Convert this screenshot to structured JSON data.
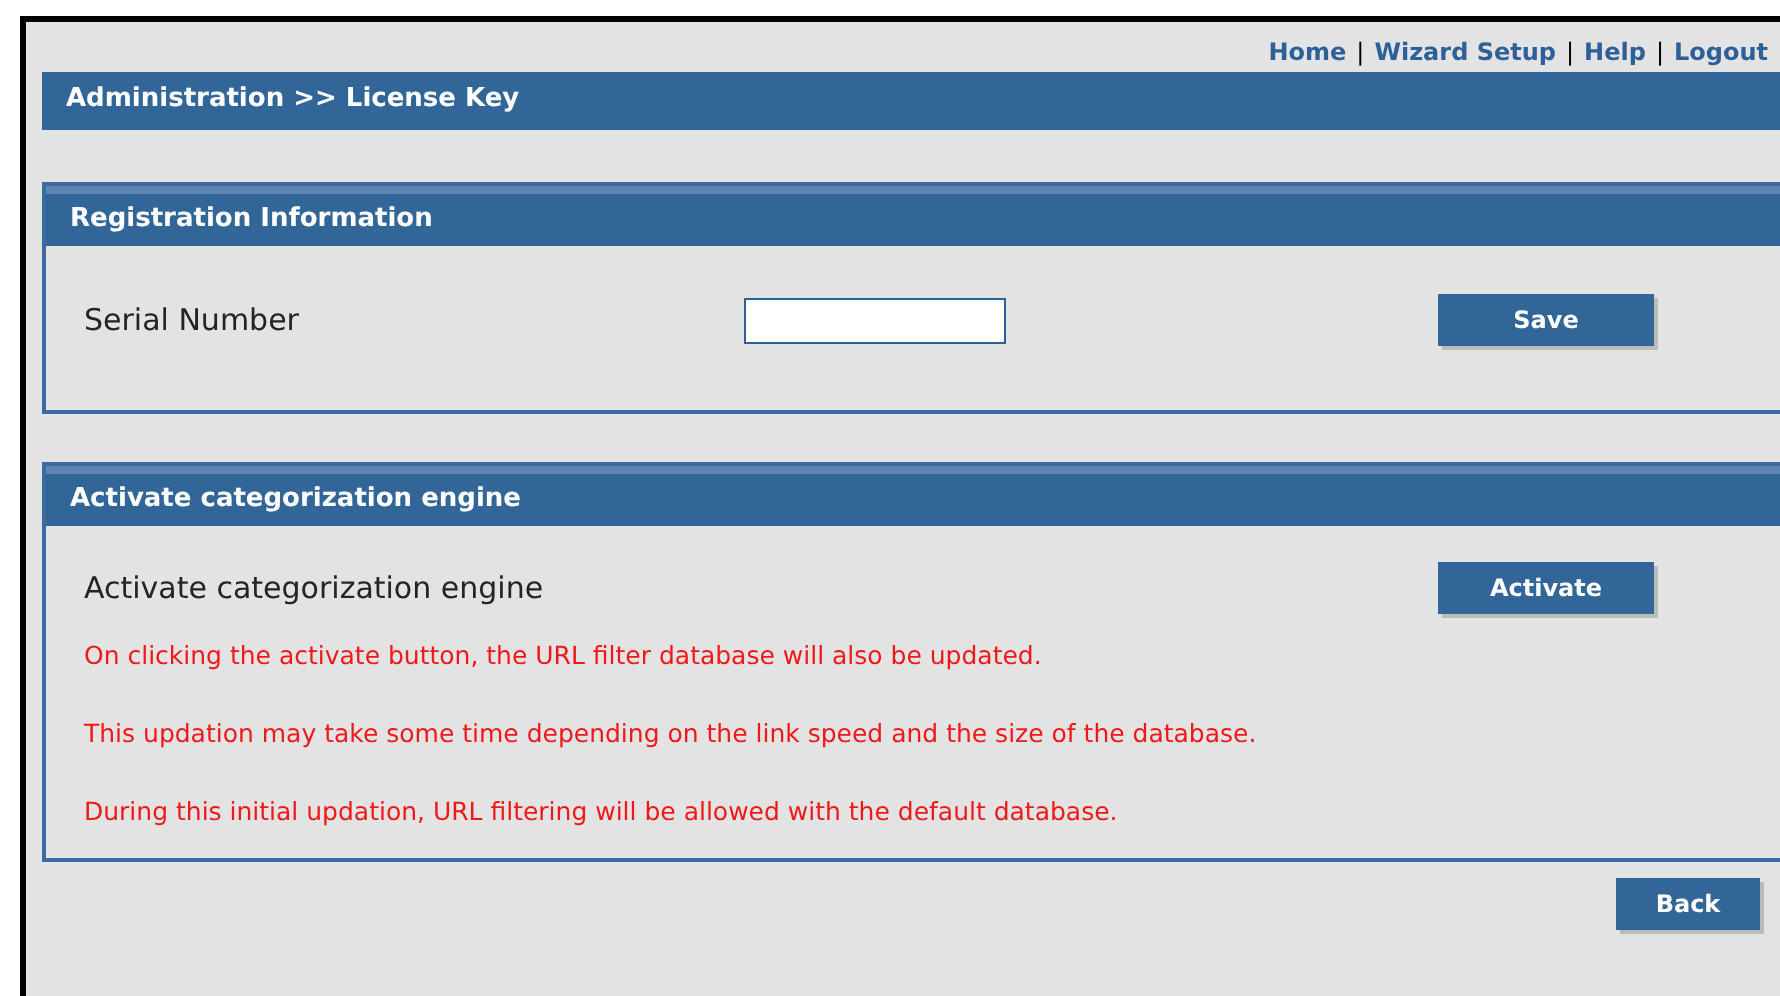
{
  "top_links": [
    {
      "kind": "link",
      "text": "Home"
    },
    {
      "kind": "separator",
      "text": "|"
    },
    {
      "kind": "link",
      "text": "Wizard Setup"
    },
    {
      "kind": "separator",
      "text": "|"
    },
    {
      "kind": "link",
      "text": "Help"
    },
    {
      "kind": "separator",
      "text": "|"
    },
    {
      "kind": "link",
      "text": "Logout"
    }
  ],
  "breadcrumb": "Administration >> License Key",
  "registration": {
    "title": "Registration Information",
    "field_label": "Serial Number",
    "button": "Save"
  },
  "activation": {
    "title": "Activate categorization engine",
    "label": "Activate categorization engine",
    "button": "Activate",
    "notes": [
      "On clicking the activate button, the URL filter database will also be updated.",
      "This updation may take some time depending on the link speed and the size of the database.",
      "During this initial updation, URL filtering will be allowed with the default database."
    ]
  },
  "back_button": "Back"
}
